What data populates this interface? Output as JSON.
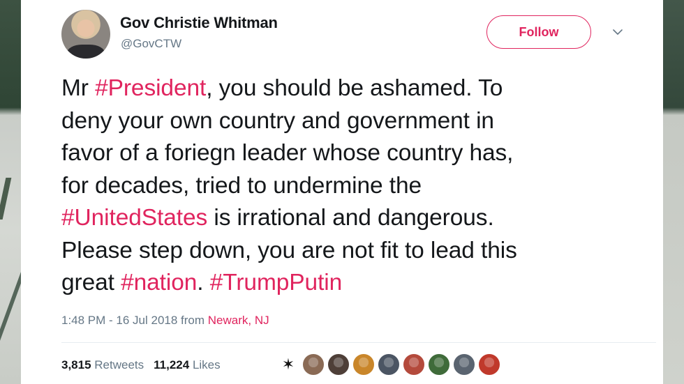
{
  "user": {
    "display_name": "Gov Christie Whitman",
    "handle": "@GovCTW"
  },
  "follow_label": "Follow",
  "tweet": {
    "lines": [
      [
        {
          "t": "Mr ",
          "h": false
        },
        {
          "t": "#President",
          "h": true
        },
        {
          "t": ", you should be ashamed. To",
          "h": false
        }
      ],
      [
        {
          "t": "deny your own country and government in",
          "h": false
        }
      ],
      [
        {
          "t": "favor of a foriegn leader whose country has,",
          "h": false
        }
      ],
      [
        {
          "t": "for decades, tried to undermine the",
          "h": false
        }
      ],
      [
        {
          "t": "#UnitedStates",
          "h": true
        },
        {
          "t": " is irrational and dangerous.",
          "h": false
        }
      ],
      [
        {
          "t": "Please step down, you are not fit to lead this",
          "h": false
        }
      ],
      [
        {
          "t": "great ",
          "h": false
        },
        {
          "t": "#nation",
          "h": true
        },
        {
          "t": ". ",
          "h": false
        },
        {
          "t": "#TrumpPutin",
          "h": true
        }
      ]
    ]
  },
  "meta": {
    "time": "1:48 PM - 16 Jul 2018 from ",
    "location": "Newark, NJ"
  },
  "stats": {
    "retweets_count": "3,815",
    "retweets_label": "Retweets",
    "likes_count": "11,224",
    "likes_label": "Likes"
  },
  "likers": [
    {
      "icon": "rebel-alliance-icon",
      "color": "#ffffff"
    },
    {
      "icon": "avatar",
      "color": "#8a6a55"
    },
    {
      "icon": "avatar",
      "color": "#4e3f38"
    },
    {
      "icon": "avatar",
      "color": "#c9862a"
    },
    {
      "icon": "avatar",
      "color": "#4b5563"
    },
    {
      "icon": "avatar",
      "color": "#b44a3c"
    },
    {
      "icon": "avatar",
      "color": "#3f6b3a"
    },
    {
      "icon": "avatar",
      "color": "#5a6470"
    },
    {
      "icon": "avatar",
      "color": "#c0392b"
    }
  ],
  "colors": {
    "accent": "#e0245e",
    "text": "#14171a",
    "secondary": "#657786"
  }
}
